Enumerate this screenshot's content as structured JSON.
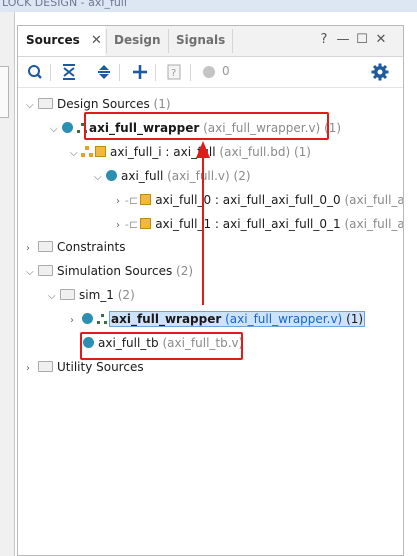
{
  "window": {
    "title_fragment": "LOCK DESIGN - axi_full"
  },
  "tabs": [
    {
      "label": "Sources",
      "active": true
    },
    {
      "label": "Design",
      "active": false
    },
    {
      "label": "Signals",
      "active": false
    }
  ],
  "window_controls": {
    "help": "?",
    "minimize": "—",
    "restore": "☐",
    "close": "✕"
  },
  "toolbar": {
    "counter": "0"
  },
  "tree": {
    "design_sources": {
      "label": "Design Sources",
      "count": "(1)"
    },
    "wrapper": {
      "name": "axi_full_wrapper",
      "file": "(axi_full_wrapper.v)",
      "count": "(1)"
    },
    "inst": {
      "name": "axi_full_i : axi_full",
      "file": "(axi_full.bd)",
      "count": "(1)"
    },
    "bd": {
      "name": "axi_full",
      "file": "(axi_full.v)",
      "count": "(2)"
    },
    "m0": {
      "name": "axi_full_0 : axi_full_axi_full_0_0",
      "file": "(axi_full_axi"
    },
    "m1": {
      "name": "axi_full_1 : axi_full_axi_full_0_1",
      "file": "(axi_full_axi"
    },
    "constraints": {
      "label": "Constraints"
    },
    "sim_sources": {
      "label": "Simulation Sources",
      "count": "(2)"
    },
    "sim1": {
      "label": "sim_1",
      "count": "(2)"
    },
    "sim_wrapper": {
      "name": "axi_full_wrapper",
      "file": "(axi_full_wrapper.v)",
      "count": "(1)"
    },
    "tb": {
      "name": "axi_full_tb",
      "file": "(axi_full_tb.v)"
    },
    "utility": {
      "label": "Utility Sources"
    }
  },
  "colors": {
    "highlight_box": "#e11a1a",
    "selection": "#cde2fb",
    "dot": "#2a8fb0",
    "bd_icon": "#f0b83c"
  },
  "icons": [
    "search-icon",
    "collapse-all-icon",
    "expand-all-icon",
    "add-icon",
    "help-doc-icon",
    "status-dot-icon",
    "gear-icon"
  ]
}
